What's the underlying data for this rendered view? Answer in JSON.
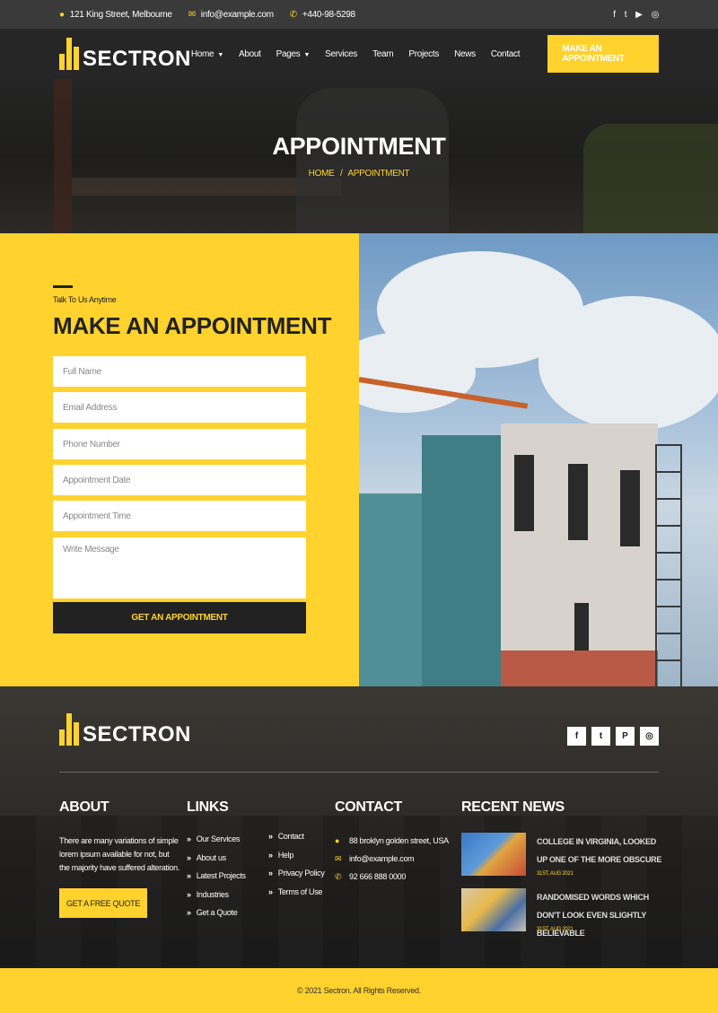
{
  "topbar": {
    "address": "121 King Street, Melbourne",
    "email": "info@example.com",
    "phone": "+440-98-5298",
    "social": [
      "f",
      "t",
      "▶",
      "◎"
    ]
  },
  "brand": {
    "name": "SECTRON"
  },
  "nav": {
    "items": [
      "Home",
      "About",
      "Pages",
      "Services",
      "Team",
      "Projects",
      "News",
      "Contact"
    ],
    "cta": "MAKE AN APPOINTMENT"
  },
  "banner": {
    "title": "APPOINTMENT",
    "breadcrumb_home": "HOME",
    "breadcrumb_sep": "/",
    "breadcrumb_current": "APPOINTMENT"
  },
  "form": {
    "kicker": "Talk To Us Anytime",
    "title": "MAKE AN APPOINTMENT",
    "placeholders": {
      "name": "Full Name",
      "email": "Email Address",
      "phone": "Phone Number",
      "date": "Appointment Date",
      "time": "Appointment Time",
      "message": "Write Message"
    },
    "submit": "GET AN APPOINTMENT"
  },
  "footer": {
    "social": [
      "f",
      "t",
      "P",
      "◎"
    ],
    "about": {
      "heading": "ABOUT",
      "text": "There are many variations of simple lorem ipsum available for not, but the majority have suffered alteration.",
      "button": "GET A FREE QUOTE"
    },
    "links": {
      "heading": "LINKS",
      "col1": [
        "Our Services",
        "About us",
        "Latest Projects",
        "Industries",
        "Get a Quote"
      ],
      "col2": [
        "Contact",
        "Help",
        "Privacy Policy",
        "Terms of Use"
      ]
    },
    "contact": {
      "heading": "CONTACT",
      "address": "88 broklyn golden street, USA",
      "email": "info@example.com",
      "phone": "92 666 888 0000"
    },
    "news": {
      "heading": "RECENT NEWS",
      "items": [
        {
          "title": "COLLEGE IN VIRGINIA, LOOKED UP ONE OF THE MORE OBSCURE",
          "date": "31ST, AUG 2021"
        },
        {
          "title": "RANDOMISED WORDS WHICH DON'T LOOK EVEN SLIGHTLY BELIEVABLE",
          "date": "31ST, AUG 2021"
        }
      ]
    },
    "copyright": "© 2021 Sectron. All Rights Reserved."
  },
  "colors": {
    "accent": "#ffd22e",
    "dark": "#222222"
  }
}
